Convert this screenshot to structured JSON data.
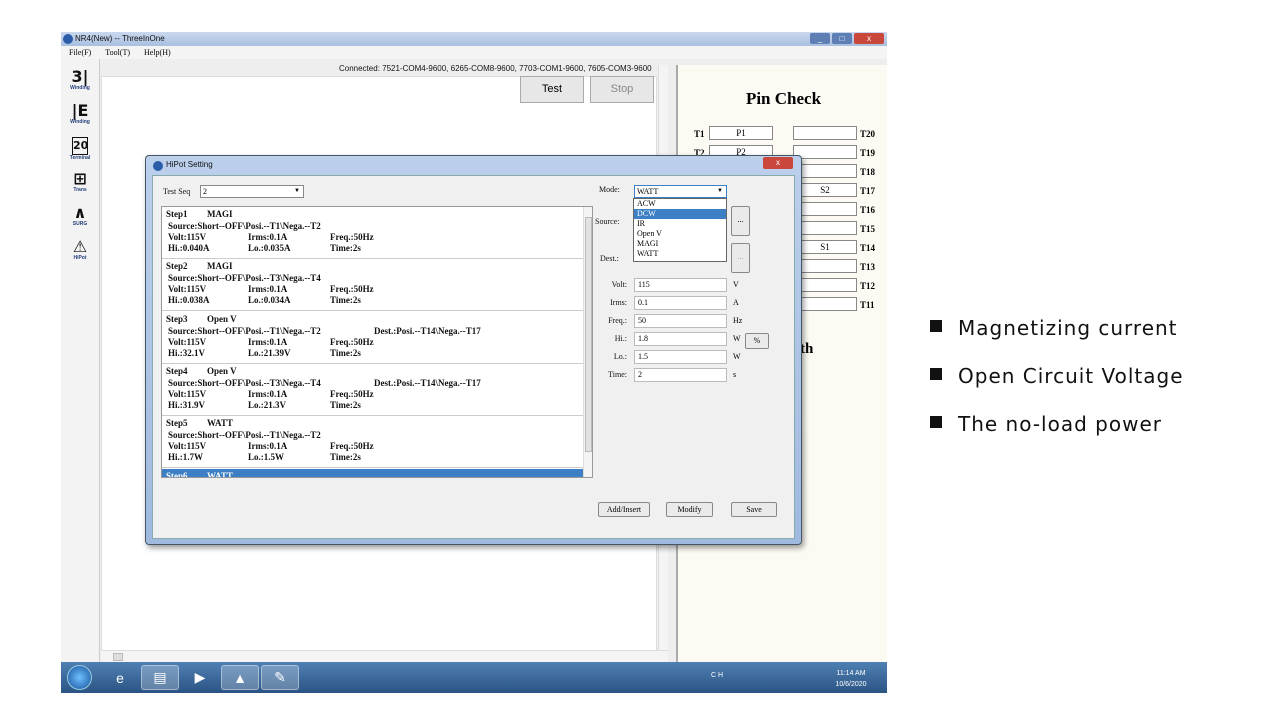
{
  "window": {
    "title": "NR4(New) -- ThreeInOne",
    "min_label": "_",
    "max_label": "□",
    "close_label": "x"
  },
  "menu": [
    "File(F)",
    "Tool(T)",
    "Help(H)"
  ],
  "toolbar": [
    {
      "icon": "3|",
      "label": "Winding"
    },
    {
      "icon": "|E",
      "label": "Winding"
    },
    {
      "icon": "20",
      "label": "Terminal"
    },
    {
      "icon": "⊞",
      "label": "Trans"
    },
    {
      "icon": "∧",
      "label": "SURG"
    },
    {
      "icon": "⚠",
      "label": "HiPot"
    }
  ],
  "status": {
    "connected": "Connected: 7521-COM4-9600, 6265-COM8-9600, 7703-COM1-9600, 7605-COM3-9600"
  },
  "buttons": {
    "test": "Test",
    "stop": "Stop"
  },
  "pin_check": {
    "title": "Pin Check",
    "rows": [
      {
        "l": "T1",
        "lv": "P1",
        "rv": "",
        "r": "T20"
      },
      {
        "l": "T2",
        "lv": "P2",
        "rv": "",
        "r": "T19"
      },
      {
        "l": "",
        "lv": "",
        "rv": "",
        "r": "T18"
      },
      {
        "l": "",
        "lv": "",
        "rv": "S2",
        "r": "T17"
      },
      {
        "l": "",
        "lv": "",
        "rv": "",
        "r": "T16"
      },
      {
        "l": "",
        "lv": "",
        "rv": "",
        "r": "T15"
      },
      {
        "l": "",
        "lv": "",
        "rv": "S1",
        "r": "T14"
      },
      {
        "l": "",
        "lv": "",
        "rv": "",
        "r": "T13"
      },
      {
        "l": "",
        "lv": "",
        "rv": "",
        "r": "T12"
      },
      {
        "l": "",
        "lv": "",
        "rv": "",
        "r": "T11"
      }
    ],
    "partial_label": "th"
  },
  "dialog": {
    "title": "HiPot Setting",
    "close": "x",
    "test_seq_label": "Test Seq",
    "test_seq_value": "2",
    "steps": [
      {
        "name": "Step1",
        "mode": "MAGI",
        "l1": "Source:Short--OFF\\Posi.--T1\\Nega.--T2",
        "l1b": "",
        "volt": "Volt:115V",
        "irms": "Irms:0.1A",
        "freq": "Freq.:50Hz",
        "hi": "Hi.:0.040A",
        "lo": "Lo.:0.035A",
        "time": "Time:2s"
      },
      {
        "name": "Step2",
        "mode": "MAGI",
        "l1": "Source:Short--OFF\\Posi.--T3\\Nega.--T4",
        "l1b": "",
        "volt": "Volt:115V",
        "irms": "Irms:0.1A",
        "freq": "Freq.:50Hz",
        "hi": "Hi.:0.038A",
        "lo": "Lo.:0.034A",
        "time": "Time:2s"
      },
      {
        "name": "Step3",
        "mode": "Open V",
        "l1": "Source:Short--OFF\\Posi.--T1\\Nega.--T2",
        "l1b": "Dest.:Posi.--T14\\Nega.--T17",
        "volt": "Volt:115V",
        "irms": "Irms:0.1A",
        "freq": "Freq.:50Hz",
        "hi": "Hi.:32.1V",
        "lo": "Lo.:21.39V",
        "time": "Time:2s"
      },
      {
        "name": "Step4",
        "mode": "Open V",
        "l1": "Source:Short--OFF\\Posi.--T3\\Nega.--T4",
        "l1b": "Dest.:Posi.--T14\\Nega.--T17",
        "volt": "Volt:115V",
        "irms": "Irms:0.1A",
        "freq": "Freq.:50Hz",
        "hi": "Hi.:31.9V",
        "lo": "Lo.:21.3V",
        "time": "Time:2s"
      },
      {
        "name": "Step5",
        "mode": "WATT",
        "l1": "Source:Short--OFF\\Posi.--T1\\Nega.--T2",
        "l1b": "",
        "volt": "Volt:115V",
        "irms": "Irms:0.1A",
        "freq": "Freq.:50Hz",
        "hi": "Hi.:1.7W",
        "lo": "Lo.:1.5W",
        "time": "Time:2s"
      },
      {
        "name": "Step6",
        "mode": "WATT",
        "l1": "",
        "l1b": "",
        "volt": "",
        "irms": "",
        "freq": "",
        "hi": "",
        "lo": "",
        "time": ""
      }
    ],
    "mode_label": "Mode:",
    "mode_value": "WATT",
    "mode_options": [
      "ACW",
      "DCW",
      "IR",
      "Open V",
      "MAGI",
      "WATT"
    ],
    "mode_highlight": "DCW",
    "source_label": "Source:",
    "dest_label": "Dest.:",
    "browse": "...",
    "fields": [
      {
        "label": "Volt:",
        "value": "115",
        "unit": "V"
      },
      {
        "label": "Irms:",
        "value": "0.1",
        "unit": "A"
      },
      {
        "label": "Freq.:",
        "value": "50",
        "unit": "Hz"
      },
      {
        "label": "Hi.:",
        "value": "1.8",
        "unit": "W"
      },
      {
        "label": "Lo.:",
        "value": "1.5",
        "unit": "W"
      },
      {
        "label": "Time:",
        "value": "2",
        "unit": "s"
      }
    ],
    "percent": "%",
    "add_insert": "Add/Insert",
    "modify": "Modify",
    "save": "Save"
  },
  "taskbar": {
    "tray": "CH",
    "time": "11:14 AM",
    "date": "10/6/2020"
  },
  "notes": [
    "Magnetizing current",
    "Open Circuit Voltage",
    "The no-load power"
  ]
}
